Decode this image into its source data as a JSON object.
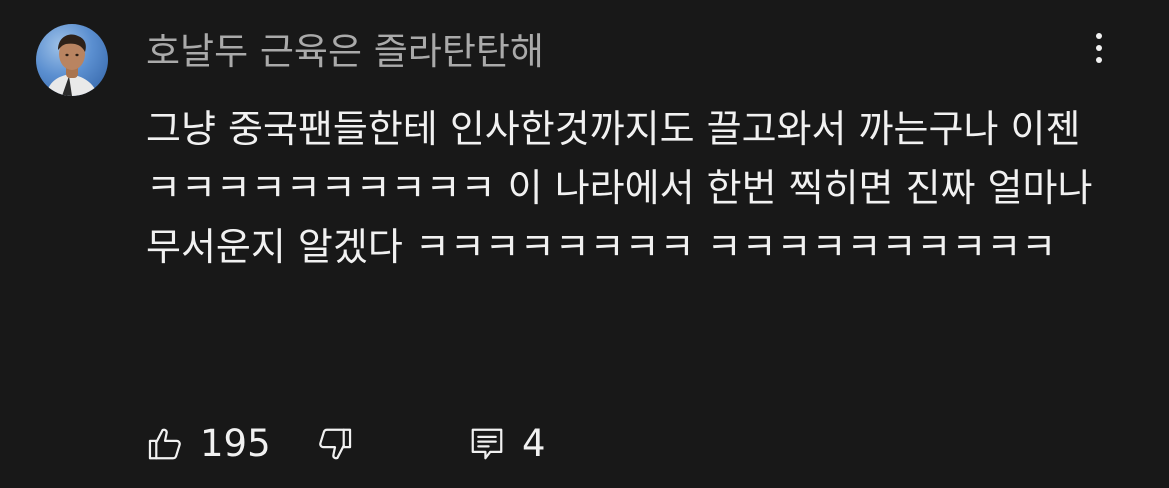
{
  "comment": {
    "author": "호날두 근육은 즐라탄탄해",
    "text": "그냥 중국팬들한테 인사한것까지도 끌고와서 까는구나 이젠 ㅋㅋㅋㅋㅋㅋㅋㅋㅋㅋ 이 나라에서 한번 찍히면 진짜 얼마나 무서운지 알겠다 ㅋㅋㅋㅋㅋㅋㅋㅋ ㅋㅋㅋㅋㅋㅋㅋㅋㅋㅋ",
    "like_count": "195",
    "reply_count": "4"
  },
  "icons": {
    "like": "thumbs-up-icon",
    "dislike": "thumbs-down-icon",
    "reply": "comment-icon",
    "menu": "more-vertical-icon"
  },
  "colors": {
    "background": "#181818",
    "text": "#f1f1f1",
    "author": "#aaaaaa",
    "avatar_sky": "#5b8fd0"
  }
}
